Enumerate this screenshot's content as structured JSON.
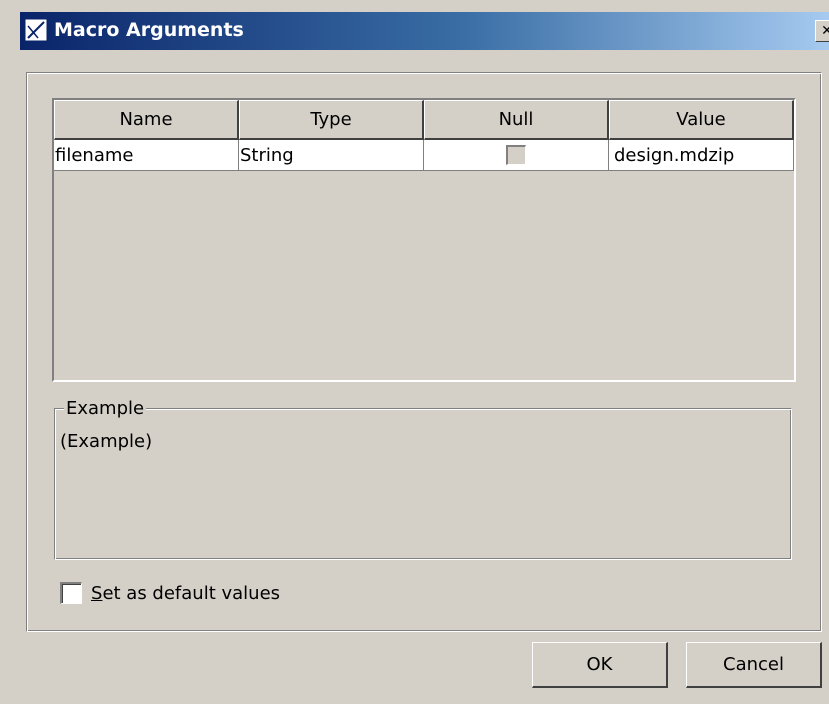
{
  "window": {
    "title": "Macro Arguments",
    "close_glyph": "✕"
  },
  "table": {
    "columns": [
      "Name",
      "Type",
      "Null",
      "Value"
    ],
    "rows": [
      {
        "name": "filename",
        "type": "String",
        "null": false,
        "value": "design.mdzip"
      }
    ]
  },
  "example": {
    "legend": "Example",
    "text": "(Example)"
  },
  "default_checkbox": {
    "mnemonic": "S",
    "label_rest": "et as default values",
    "checked": false
  },
  "buttons": {
    "ok": "OK",
    "cancel": "Cancel"
  },
  "colors": {
    "dialog_bg": "#d4d0c8",
    "title_gradient_start": "#0a246a",
    "title_gradient_end": "#a6caf0"
  }
}
